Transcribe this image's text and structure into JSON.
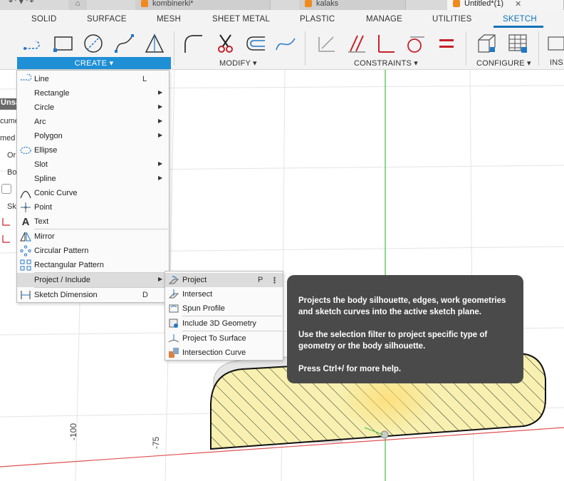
{
  "doc_tabs": {
    "tab1": "kombinerki*",
    "tab2": "kalaks",
    "tab3": "Untitled*(1)"
  },
  "ribbon": {
    "tabs": [
      "SOLID",
      "SURFACE",
      "MESH",
      "SHEET METAL",
      "PLASTIC",
      "MANAGE",
      "UTILITIES",
      "SKETCH"
    ],
    "active_tab": "SKETCH",
    "groups": {
      "create": "CREATE ▾",
      "modify": "MODIFY ▾",
      "constraints": "CONSTRAINTS ▾",
      "configure": "CONFIGURE ▾",
      "insert": "INS"
    },
    "accent_color": "#0f72b9"
  },
  "browser": {
    "unsaved": "Unsa",
    "row2": "cume",
    "row3": "med",
    "row4": "Or",
    "row5": "Bo",
    "row6": "Sk"
  },
  "create_menu": {
    "items": [
      {
        "label": "Line",
        "shortcut": "L",
        "submenu": false
      },
      {
        "label": "Rectangle",
        "shortcut": "",
        "submenu": true
      },
      {
        "label": "Circle",
        "shortcut": "",
        "submenu": true
      },
      {
        "label": "Arc",
        "shortcut": "",
        "submenu": true
      },
      {
        "label": "Polygon",
        "shortcut": "",
        "submenu": true
      },
      {
        "label": "Ellipse",
        "shortcut": "",
        "submenu": false
      },
      {
        "label": "Slot",
        "shortcut": "",
        "submenu": true
      },
      {
        "label": "Spline",
        "shortcut": "",
        "submenu": true
      },
      {
        "label": "Conic Curve",
        "shortcut": "",
        "submenu": false
      },
      {
        "label": "Point",
        "shortcut": "",
        "submenu": false
      },
      {
        "label": "Text",
        "shortcut": "",
        "submenu": false
      },
      {
        "label": "Mirror",
        "shortcut": "",
        "submenu": false
      },
      {
        "label": "Circular Pattern",
        "shortcut": "",
        "submenu": false
      },
      {
        "label": "Rectangular Pattern",
        "shortcut": "",
        "submenu": false
      },
      {
        "label": "Project / Include",
        "shortcut": "",
        "submenu": true
      },
      {
        "label": "Sketch Dimension",
        "shortcut": "D",
        "submenu": false
      }
    ],
    "highlighted": "Project / Include"
  },
  "project_menu": {
    "items": [
      {
        "label": "Project",
        "shortcut": "P"
      },
      {
        "label": "Intersect",
        "shortcut": ""
      },
      {
        "label": "Spun Profile",
        "shortcut": ""
      },
      {
        "label": "Include 3D Geometry",
        "shortcut": ""
      },
      {
        "label": "Project To Surface",
        "shortcut": ""
      },
      {
        "label": "Intersection Curve",
        "shortcut": ""
      }
    ],
    "highlighted": "Project",
    "more_icon": "vertical-dots-icon"
  },
  "tooltip": {
    "line1": "Projects the body silhouette, edges, work geometries and sketch curves into the active sketch plane.",
    "line2": "Use the selection filter to project specific type of geometry or the body silhouette.",
    "line3": "Press Ctrl+/ for more help."
  },
  "viewport": {
    "axis_labels": [
      "-100",
      "-75"
    ],
    "profile_fill": "#f7f0b0",
    "x_axis_color": "#e05050",
    "y_axis_color": "#40c040"
  }
}
